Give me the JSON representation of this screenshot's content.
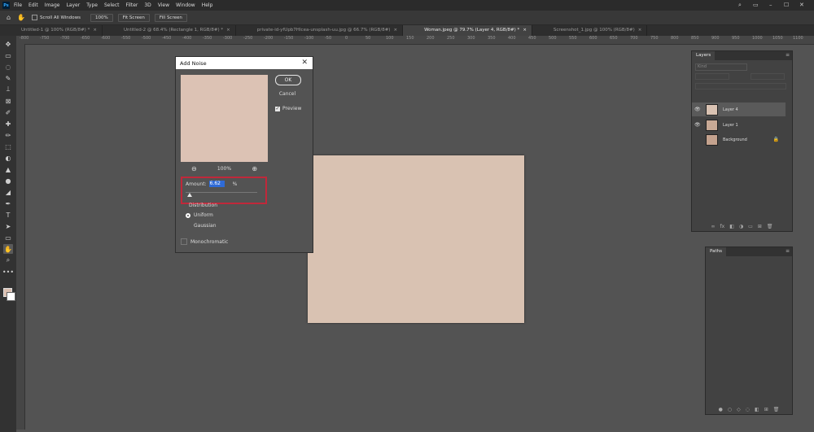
{
  "app": {
    "logo": "Ps"
  },
  "menubar": {
    "items": [
      "File",
      "Edit",
      "Image",
      "Layer",
      "Type",
      "Select",
      "Filter",
      "3D",
      "View",
      "Window",
      "Help"
    ],
    "controls": [
      "⌕",
      "▭",
      "–",
      "☐",
      "✕"
    ]
  },
  "options": {
    "scroll_all_windows": "Scroll All Windows",
    "zoom_100": "100%",
    "fit_screen": "Fit Screen",
    "fill_screen": "Fill Screen"
  },
  "tabs": [
    {
      "label": "Untitled-1 @ 100% (RGB/8#) *"
    },
    {
      "label": "Untitled-2 @ 68.4% (Rectangle 1, RGB/8#) *"
    },
    {
      "label": "private-id-yfUpb7HIcea-unsplash-uu.jpg @ 66.7% (RGB/8#)"
    },
    {
      "label": "Woman.jpeg @ 79.7% (Layer 4, RGB/8#) *",
      "active": true
    },
    {
      "label": "Screenshot_1.jpg @ 100% (RGB/8#)"
    }
  ],
  "ruler": {
    "top": [
      "-800",
      "-750",
      "-700",
      "-650",
      "-600",
      "-550",
      "-500",
      "-450",
      "-400",
      "-350",
      "-300",
      "-250",
      "-200",
      "-150",
      "-100",
      "-50",
      "0",
      "50",
      "100",
      "150",
      "200",
      "250",
      "300",
      "350",
      "400",
      "450",
      "500",
      "550",
      "600",
      "650",
      "700",
      "750",
      "800",
      "850",
      "900",
      "950",
      "1000",
      "1050",
      "1100"
    ]
  },
  "tools": [
    "✥",
    "▭",
    "◌",
    "✎",
    "⟘",
    "⊠",
    "✐",
    "✚",
    "✏",
    "⬚",
    "◐",
    "▲",
    "●",
    "◢",
    "✒",
    "T",
    "➤",
    "▭",
    "✋",
    "⌕",
    "•••"
  ],
  "dialog": {
    "title": "Add Noise",
    "ok": "OK",
    "cancel": "Cancel",
    "preview_label": "Preview",
    "zoom_level": "100%",
    "zoom_out": "⊖",
    "zoom_in": "⊕",
    "amount_label": "Amount:",
    "amount_value": "6.62",
    "amount_unit": "%",
    "amount_percent": 6.62,
    "distribution_label": "Distribution",
    "uniform": "Uniform",
    "gaussian": "Gaussian",
    "monochromatic": "Monochromatic",
    "close": "✕"
  },
  "layers_panel": {
    "title": "Layers",
    "search_placeholder": "Kind",
    "layers": [
      {
        "name": "Layer 4",
        "visible": true,
        "selected": true
      },
      {
        "name": "Layer 1",
        "visible": true,
        "selected": false
      },
      {
        "name": "Background",
        "visible": false,
        "selected": false,
        "locked": true
      }
    ],
    "footer_icons": [
      "∞",
      "fx",
      "◧",
      "◑",
      "▭",
      "⊞",
      "🗑"
    ]
  },
  "paths_panel": {
    "title": "Paths",
    "footer_icons": [
      "●",
      "○",
      "◇",
      "◌",
      "◧",
      "⊞",
      "🗑"
    ]
  },
  "colors": {
    "foreground": "#dbbfb0",
    "background": "#ffffff",
    "canvas_fill": "#d9c2b2",
    "highlight": "#c0283a"
  }
}
